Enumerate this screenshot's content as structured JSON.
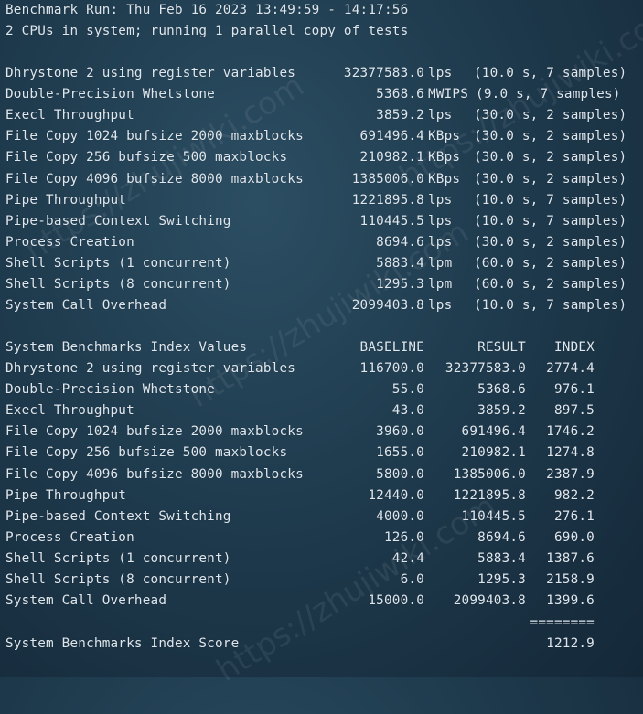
{
  "header": {
    "run_line": "Benchmark Run: Thu Feb 16 2023 13:49:59 - 14:17:56",
    "cpu_line": "2 CPUs in system; running 1 parallel copy of tests"
  },
  "results": [
    {
      "name": "Dhrystone 2 using register variables",
      "value": "32377583.0",
      "unit": "lps",
      "detail": "(10.0 s, 7 samples)"
    },
    {
      "name": "Double-Precision Whetstone",
      "value": "5368.6",
      "unit": "MWIPS",
      "detail": "(9.0 s, 7 samples)"
    },
    {
      "name": "Execl Throughput",
      "value": "3859.2",
      "unit": "lps",
      "detail": "(30.0 s, 2 samples)"
    },
    {
      "name": "File Copy 1024 bufsize 2000 maxblocks",
      "value": "691496.4",
      "unit": "KBps",
      "detail": "(30.0 s, 2 samples)"
    },
    {
      "name": "File Copy 256 bufsize 500 maxblocks",
      "value": "210982.1",
      "unit": "KBps",
      "detail": "(30.0 s, 2 samples)"
    },
    {
      "name": "File Copy 4096 bufsize 8000 maxblocks",
      "value": "1385006.0",
      "unit": "KBps",
      "detail": "(30.0 s, 2 samples)"
    },
    {
      "name": "Pipe Throughput",
      "value": "1221895.8",
      "unit": "lps",
      "detail": "(10.0 s, 7 samples)"
    },
    {
      "name": "Pipe-based Context Switching",
      "value": "110445.5",
      "unit": "lps",
      "detail": "(10.0 s, 7 samples)"
    },
    {
      "name": "Process Creation",
      "value": "8694.6",
      "unit": "lps",
      "detail": "(30.0 s, 2 samples)"
    },
    {
      "name": "Shell Scripts (1 concurrent)",
      "value": "5883.4",
      "unit": "lpm",
      "detail": "(60.0 s, 2 samples)"
    },
    {
      "name": "Shell Scripts (8 concurrent)",
      "value": "1295.3",
      "unit": "lpm",
      "detail": "(60.0 s, 2 samples)"
    },
    {
      "name": "System Call Overhead",
      "value": "2099403.8",
      "unit": "lps",
      "detail": "(10.0 s, 7 samples)"
    }
  ],
  "index_table": {
    "title": "System Benchmarks Index Values",
    "col_baseline": "BASELINE",
    "col_result": "RESULT",
    "col_index": "INDEX",
    "rows": [
      {
        "name": "Dhrystone 2 using register variables",
        "baseline": "116700.0",
        "result": "32377583.0",
        "index": "2774.4"
      },
      {
        "name": "Double-Precision Whetstone",
        "baseline": "55.0",
        "result": "5368.6",
        "index": "976.1"
      },
      {
        "name": "Execl Throughput",
        "baseline": "43.0",
        "result": "3859.2",
        "index": "897.5"
      },
      {
        "name": "File Copy 1024 bufsize 2000 maxblocks",
        "baseline": "3960.0",
        "result": "691496.4",
        "index": "1746.2"
      },
      {
        "name": "File Copy 256 bufsize 500 maxblocks",
        "baseline": "1655.0",
        "result": "210982.1",
        "index": "1274.8"
      },
      {
        "name": "File Copy 4096 bufsize 8000 maxblocks",
        "baseline": "5800.0",
        "result": "1385006.0",
        "index": "2387.9"
      },
      {
        "name": "Pipe Throughput",
        "baseline": "12440.0",
        "result": "1221895.8",
        "index": "982.2"
      },
      {
        "name": "Pipe-based Context Switching",
        "baseline": "4000.0",
        "result": "110445.5",
        "index": "276.1"
      },
      {
        "name": "Process Creation",
        "baseline": "126.0",
        "result": "8694.6",
        "index": "690.0"
      },
      {
        "name": "Shell Scripts (1 concurrent)",
        "baseline": "42.4",
        "result": "5883.4",
        "index": "1387.6"
      },
      {
        "name": "Shell Scripts (8 concurrent)",
        "baseline": "6.0",
        "result": "1295.3",
        "index": "2158.9"
      },
      {
        "name": "System Call Overhead",
        "baseline": "15000.0",
        "result": "2099403.8",
        "index": "1399.6"
      }
    ],
    "separator": "========",
    "score_label": "System Benchmarks Index Score",
    "score_value": "1212.9"
  },
  "watermark": "https://zhujiwiki.com",
  "colors": {
    "text": "#dfe7ee",
    "background": "#1f3b4e"
  }
}
